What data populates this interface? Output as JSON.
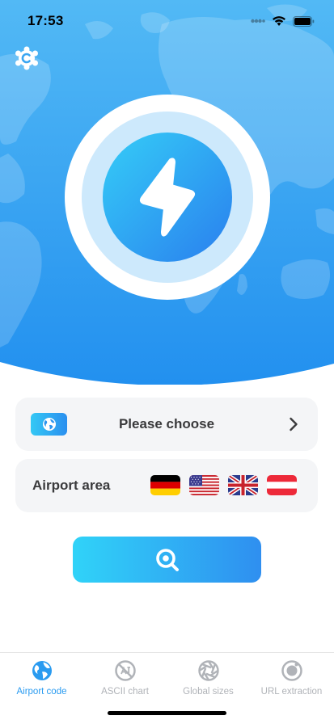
{
  "status_bar": {
    "time": "17:53"
  },
  "choose": {
    "label": "Please choose"
  },
  "area": {
    "label": "Airport area",
    "flags": [
      "germany-flag",
      "usa-flag",
      "uk-flag",
      "austria-flag"
    ]
  },
  "tabs": [
    {
      "label": "Airport code",
      "icon": "globe-icon",
      "active": true
    },
    {
      "label": "ASCII chart",
      "icon": "ascii-chart-icon",
      "active": false
    },
    {
      "label": "Global sizes",
      "icon": "aperture-icon",
      "active": false
    },
    {
      "label": "URL extraction",
      "icon": "url-extraction-icon",
      "active": false
    }
  ],
  "colors": {
    "accent": "#2a9bf0",
    "hero_top": "#4bb5f4",
    "hero_bottom": "#1e8cee",
    "card_bg": "#f4f5f7",
    "text": "#3a3a3c",
    "tab_inactive": "#b0b3b8"
  }
}
